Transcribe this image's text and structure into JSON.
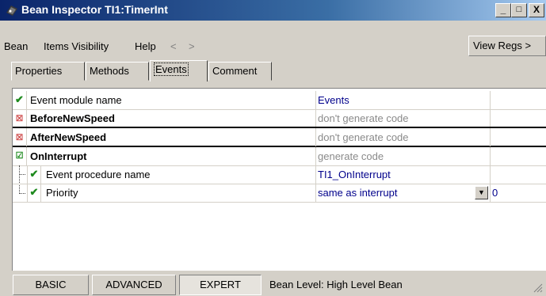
{
  "window": {
    "title": "Bean Inspector TI1:TimerInt",
    "buttons": {
      "minimize": "_",
      "maximize": "□",
      "close": "X"
    }
  },
  "menu": {
    "items": [
      "Bean",
      "Items Visibility",
      "Help"
    ],
    "back": "<",
    "forward": ">",
    "view_regs": "View Regs >"
  },
  "tabs": {
    "properties": "Properties",
    "methods": "Methods",
    "events": "Events",
    "comment": "Comment",
    "active": "Events"
  },
  "rows": [
    {
      "status": "check",
      "name": "Event module name",
      "value": "Events",
      "value_style": "blue"
    },
    {
      "status": "x",
      "name": "BeforeNewSpeed",
      "value": "don't generate code",
      "value_style": "gray"
    },
    {
      "status": "x",
      "name": "AfterNewSpeed",
      "value": "don't generate code",
      "value_style": "gray"
    },
    {
      "status": "check-box",
      "name": "OnInterrupt",
      "value": "generate code",
      "value_style": "gray"
    },
    {
      "status": "check",
      "name": "Event procedure name",
      "value": "TI1_OnInterrupt",
      "value_style": "blue"
    },
    {
      "status": "check",
      "name": "Priority",
      "value": "same as interrupt",
      "value_style": "blue",
      "extra": "0"
    }
  ],
  "bottom": {
    "basic": "BASIC",
    "advanced": "ADVANCED",
    "expert": "EXPERT",
    "level": "Bean Level: High Level Bean"
  },
  "colors": {
    "title_start": "#0a246a",
    "title_end": "#a6caf0",
    "check": "#1e8a1e",
    "x": "#c83232",
    "value_blue": "#00008b"
  }
}
